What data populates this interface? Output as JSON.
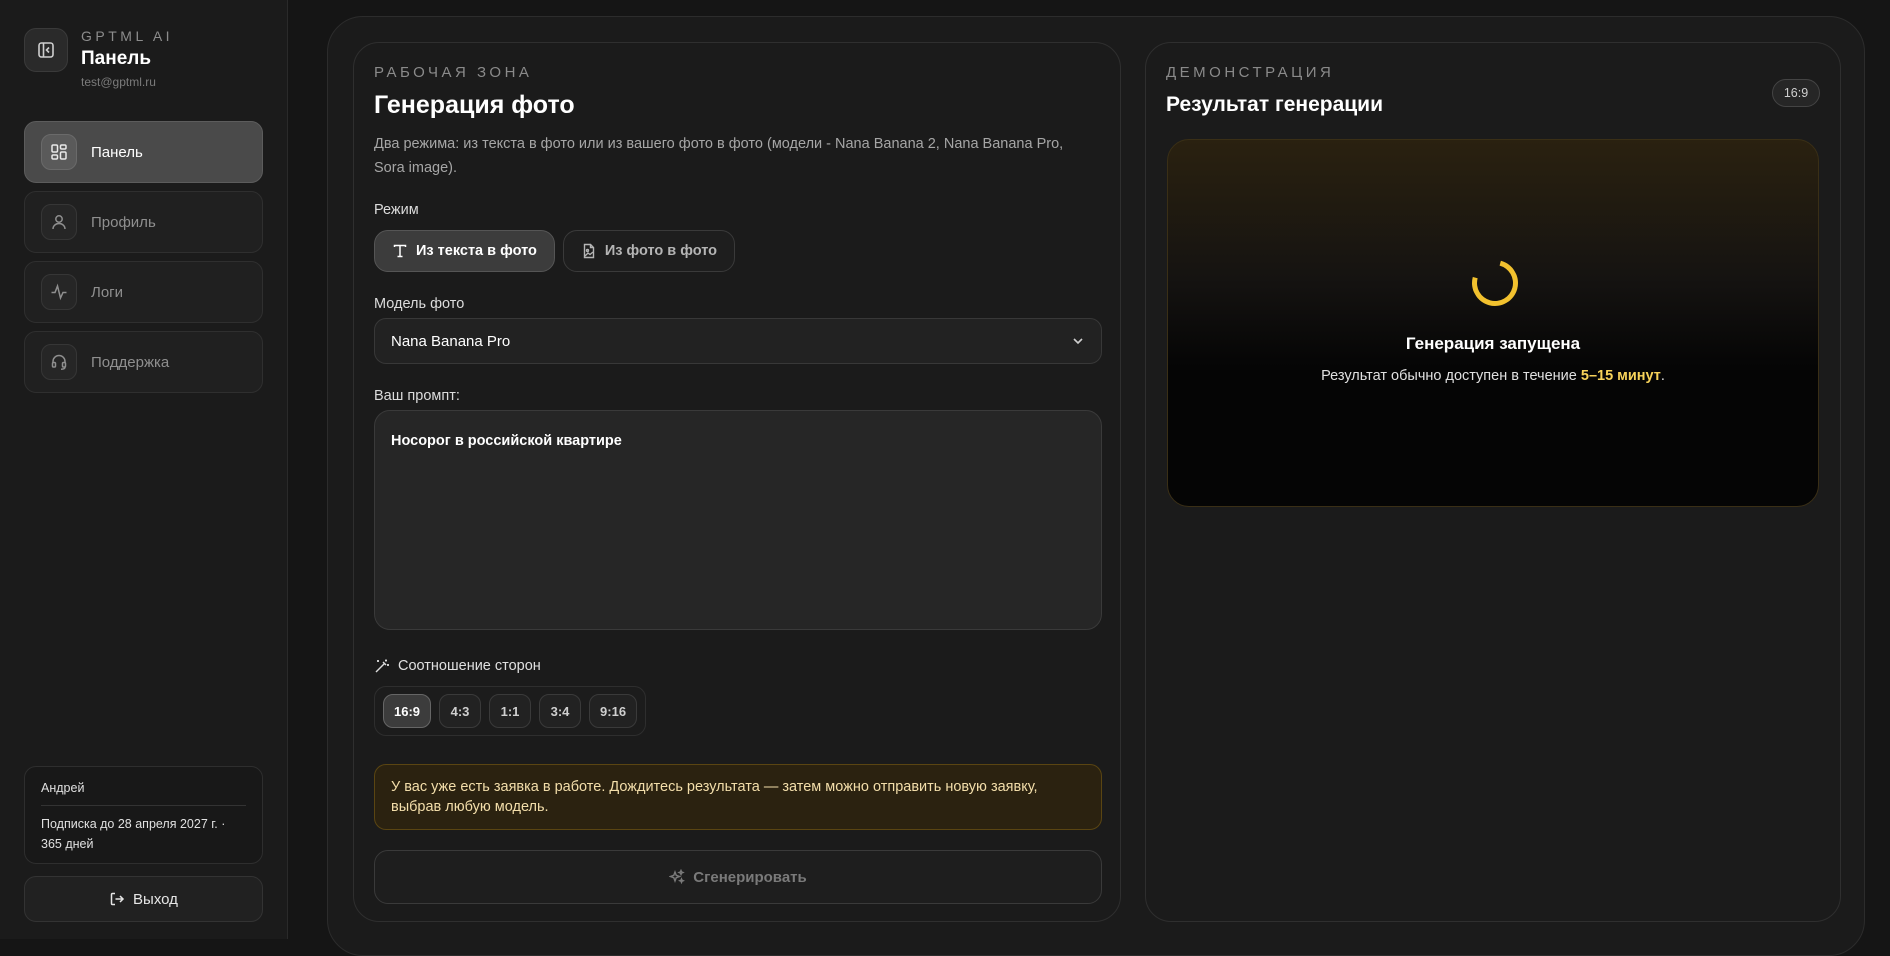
{
  "sidebar": {
    "brand": {
      "eyebrow": "GPTML AI",
      "title": "Панель",
      "email": "test@gptml.ru"
    },
    "nav": [
      {
        "label": "Панель",
        "icon": "dashboard-icon",
        "active": true
      },
      {
        "label": "Профиль",
        "icon": "user-icon",
        "active": false
      },
      {
        "label": "Логи",
        "icon": "activity-icon",
        "active": false
      },
      {
        "label": "Поддержка",
        "icon": "headset-icon",
        "active": false
      }
    ],
    "user": {
      "name": "Андрей",
      "subscription": "Подписка до 28 апреля 2027 г. · 365 дней"
    },
    "logout_label": "Выход"
  },
  "workspace": {
    "eyebrow": "РАБОЧАЯ ЗОНА",
    "title": "Генерация фото",
    "description": "Два режима: из текста в фото или из вашего фото в фото (модели - Nana Banana 2, Nana Banana Pro, Sora image).",
    "mode_label": "Режим",
    "modes": [
      {
        "label": "Из текста в фото",
        "icon": "text-icon",
        "active": true
      },
      {
        "label": "Из фото в фото",
        "icon": "image-file-icon",
        "active": false
      }
    ],
    "model_label": "Модель фото",
    "model_value": "Nana Banana Pro",
    "prompt_label": "Ваш промпт:",
    "prompt_value": "Носорог в российской квартире",
    "ratio_label": "Соотношение сторон",
    "ratios": [
      {
        "label": "16:9",
        "active": true
      },
      {
        "label": "4:3",
        "active": false
      },
      {
        "label": "1:1",
        "active": false
      },
      {
        "label": "3:4",
        "active": false
      },
      {
        "label": "9:16",
        "active": false
      }
    ],
    "warning": "У вас уже есть заявка в работе. Дождитесь результата — затем можно отправить новую заявку, выбрав любую модель.",
    "generate_label": "Сгенерировать"
  },
  "demo": {
    "eyebrow": "ДЕМОНСТРАЦИЯ",
    "title": "Результат генерации",
    "ratio_badge": "16:9",
    "status_title": "Генерация запущена",
    "status_prefix": "Результат обычно доступен в течение ",
    "status_highlight": "5–15 минут",
    "status_suffix": "."
  },
  "colors": {
    "accent": "#f2c12e",
    "warning_bg": "#2b2210",
    "warning_text": "#f3deaa"
  }
}
